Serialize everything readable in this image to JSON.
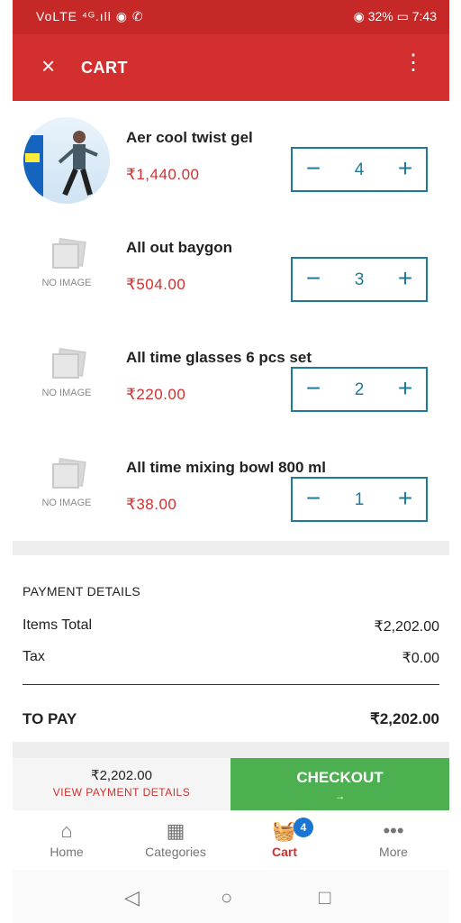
{
  "status_bar": {
    "left": "VoLTE ⁴ᴳ.ıll ◉ ✆",
    "right": "◉ 32% ▭ 7:43"
  },
  "app_bar": {
    "close_icon": "×",
    "title": "CART",
    "menu_icon": "⋮"
  },
  "cart_items": [
    {
      "name": "Aer cool twist gel",
      "price": "₹1,440.00",
      "qty": "4",
      "has_image": true
    },
    {
      "name": "All out baygon",
      "price": "₹504.00",
      "qty": "3",
      "has_image": false
    },
    {
      "name": "All time glasses 6 pcs set",
      "price": "₹220.00",
      "qty": "2",
      "has_image": false
    },
    {
      "name": "All time mixing bowl 800 ml",
      "price": "₹38.00",
      "qty": "1",
      "has_image": false
    }
  ],
  "no_image_label": "NO IMAGE",
  "stepper": {
    "minus": "−",
    "plus": "+"
  },
  "payment": {
    "title": "PAYMENT DETAILS",
    "items_total_label": "Items Total",
    "items_total_value": "₹2,202.00",
    "tax_label": "Tax",
    "tax_value": "₹0.00",
    "to_pay_label": "TO PAY",
    "to_pay_value": "₹2,202.00"
  },
  "checkout_bar": {
    "amount": "₹2,202.00",
    "view_details": "VIEW PAYMENT DETAILS",
    "button": "CHECKOUT",
    "arrow": "→"
  },
  "bottom_nav": {
    "home": {
      "label": "Home",
      "icon": "⌂"
    },
    "categories": {
      "label": "Categories",
      "icon": "▦"
    },
    "cart": {
      "label": "Cart",
      "icon": "🧺",
      "badge": "4"
    },
    "more": {
      "label": "More",
      "icon": "•••"
    }
  },
  "system_nav": {
    "back": "◁",
    "home": "○",
    "recents": "□"
  },
  "colors": {
    "primary": "#d32f2f",
    "accent": "#1f7a99",
    "checkout": "#4caf50",
    "badge": "#1976d2"
  }
}
